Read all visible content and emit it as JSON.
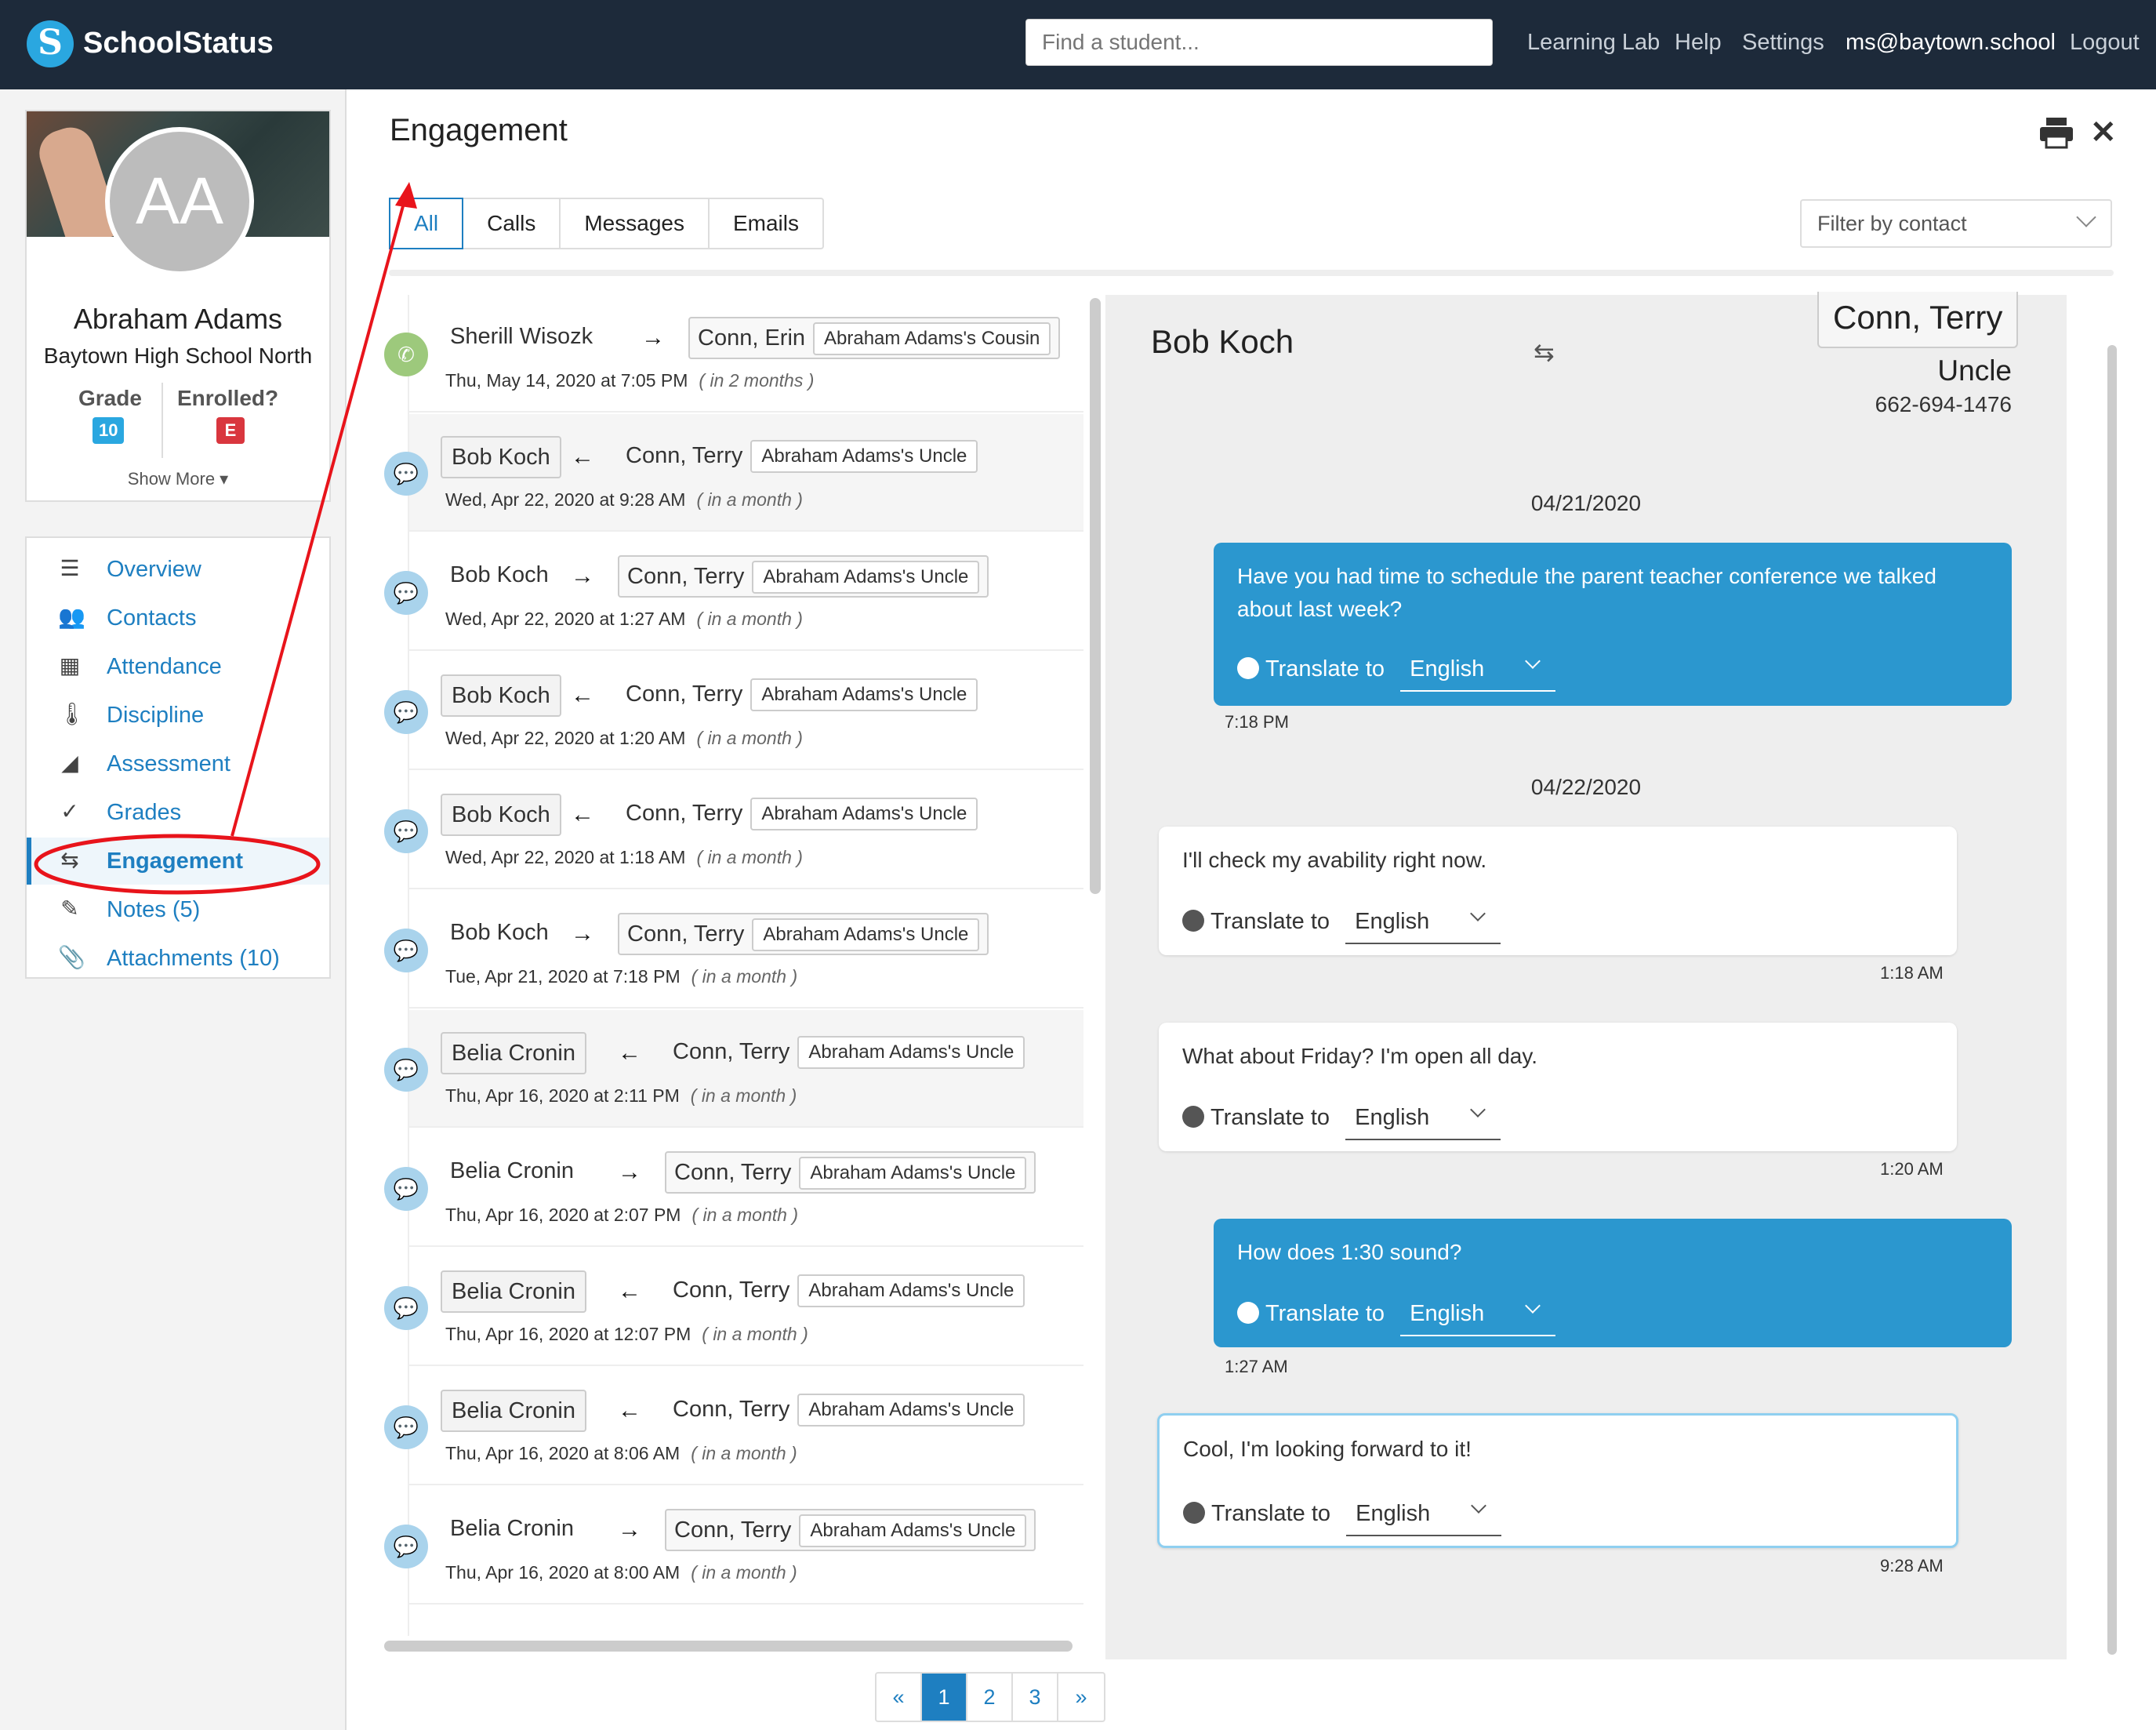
{
  "header": {
    "brand": "SchoolStatus",
    "search_placeholder": "Find a student...",
    "links": [
      "Learning Lab",
      "Help",
      "Settings"
    ],
    "user": "ms@baytown.school",
    "logout": "Logout"
  },
  "student": {
    "initials": "AA",
    "name": "Abraham Adams",
    "school": "Baytown High School North",
    "grade_label": "Grade",
    "grade": "10",
    "enrolled_label": "Enrolled?",
    "enrolled": "E",
    "show_more": "Show More ▾"
  },
  "nav": [
    {
      "label": "Overview",
      "icon": "list-icon"
    },
    {
      "label": "Contacts",
      "icon": "contacts-icon"
    },
    {
      "label": "Attendance",
      "icon": "calendar-icon"
    },
    {
      "label": "Discipline",
      "icon": "thermometer-icon"
    },
    {
      "label": "Assessment",
      "icon": "chart-icon"
    },
    {
      "label": "Grades",
      "icon": "check-icon"
    },
    {
      "label": "Engagement",
      "icon": "swap-icon",
      "active": true
    },
    {
      "label": "Notes (5)",
      "icon": "pencil-icon"
    },
    {
      "label": "Attachments (10)",
      "icon": "paperclip-icon"
    }
  ],
  "page": {
    "title": "Engagement",
    "tabs": [
      "All",
      "Calls",
      "Messages",
      "Emails"
    ],
    "active_tab": "All",
    "filter_placeholder": "Filter by contact"
  },
  "list": [
    {
      "type": "call",
      "staff": "Sherill Wisozk",
      "dir": "→",
      "contact": "Conn, Erin",
      "relation": "Abraham Adams's Cousin",
      "time": "Thu, May 14, 2020 at 7:05 PM",
      "rel_time": "( in 2 months )"
    },
    {
      "type": "message",
      "staff": "Bob Koch",
      "dir": "←",
      "contact": "Conn, Terry",
      "relation": "Abraham Adams's Uncle",
      "time": "Wed, Apr 22, 2020 at 9:28 AM",
      "rel_time": "( in a month )"
    },
    {
      "type": "message",
      "staff": "Bob Koch",
      "dir": "→",
      "contact": "Conn, Terry",
      "relation": "Abraham Adams's Uncle",
      "time": "Wed, Apr 22, 2020 at 1:27 AM",
      "rel_time": "( in a month )"
    },
    {
      "type": "message",
      "staff": "Bob Koch",
      "dir": "←",
      "contact": "Conn, Terry",
      "relation": "Abraham Adams's Uncle",
      "time": "Wed, Apr 22, 2020 at 1:20 AM",
      "rel_time": "( in a month )"
    },
    {
      "type": "message",
      "staff": "Bob Koch",
      "dir": "←",
      "contact": "Conn, Terry",
      "relation": "Abraham Adams's Uncle",
      "time": "Wed, Apr 22, 2020 at 1:18 AM",
      "rel_time": "( in a month )"
    },
    {
      "type": "message",
      "staff": "Bob Koch",
      "dir": "→",
      "contact": "Conn, Terry",
      "relation": "Abraham Adams's Uncle",
      "time": "Tue, Apr 21, 2020 at 7:18 PM",
      "rel_time": "( in a month )"
    },
    {
      "type": "message",
      "staff": "Belia Cronin",
      "dir": "←",
      "contact": "Conn, Terry",
      "relation": "Abraham Adams's Uncle",
      "time": "Thu, Apr 16, 2020 at 2:11 PM",
      "rel_time": "( in a month )"
    },
    {
      "type": "message",
      "staff": "Belia Cronin",
      "dir": "→",
      "contact": "Conn, Terry",
      "relation": "Abraham Adams's Uncle",
      "time": "Thu, Apr 16, 2020 at 2:07 PM",
      "rel_time": "( in a month )"
    },
    {
      "type": "message",
      "staff": "Belia Cronin",
      "dir": "←",
      "contact": "Conn, Terry",
      "relation": "Abraham Adams's Uncle",
      "time": "Thu, Apr 16, 2020 at 12:07 PM",
      "rel_time": "( in a month )"
    },
    {
      "type": "message",
      "staff": "Belia Cronin",
      "dir": "←",
      "contact": "Conn, Terry",
      "relation": "Abraham Adams's Uncle",
      "time": "Thu, Apr 16, 2020 at 8:06 AM",
      "rel_time": "( in a month )"
    },
    {
      "type": "message",
      "staff": "Belia Cronin",
      "dir": "→",
      "contact": "Conn, Terry",
      "relation": "Abraham Adams's Uncle",
      "time": "Thu, Apr 16, 2020 at 8:00 AM",
      "rel_time": "( in a month )"
    }
  ],
  "thread": {
    "from": "Bob Koch",
    "to": "Conn, Terry",
    "relation": "Uncle",
    "phone": "662-694-1476",
    "dates": [
      "04/21/2020",
      "04/22/2020"
    ],
    "translate_label": "Translate to",
    "language": "English",
    "messages": [
      {
        "dir": "out",
        "text": "Have you had time to schedule the parent teacher conference we talked about last week?",
        "time": "7:18 PM"
      },
      {
        "dir": "in",
        "text": "I'll check my avability right now.",
        "time": "1:18 AM"
      },
      {
        "dir": "in",
        "text": "What about Friday? I'm open all day.",
        "time": "1:20 AM"
      },
      {
        "dir": "out",
        "text": "How does 1:30 sound?",
        "time": "1:27 AM"
      },
      {
        "dir": "in",
        "text": "Cool, I'm looking forward to it!",
        "time": "9:28 AM"
      }
    ]
  },
  "pagination": [
    "«",
    "1",
    "2",
    "3",
    "»"
  ],
  "current_page": "1",
  "colors": {
    "accent": "#1e7fc1",
    "header": "#1d2a3a",
    "outgoing": "#2b97cf",
    "annotation": "#e8141b"
  }
}
